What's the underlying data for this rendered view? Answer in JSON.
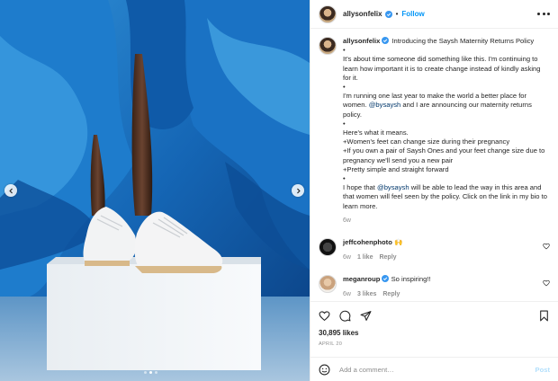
{
  "post": {
    "username": "allysonfelix",
    "follow_label": "Follow",
    "separator": "•"
  },
  "media": {
    "slide_count": 3,
    "active_slide": 1
  },
  "caption": {
    "username": "allysonfelix",
    "line1": "Introducing the Saysh Maternity Returns Policy",
    "lines": [
      "•",
      "It's about time someone did something like this. I'm continuing to learn how important it is to create change instead of kindly asking for it.",
      "•",
      "I'm running one last year to make the world a better place for women.",
      "•",
      "Here's what it means.",
      "+Women's feet can change size during their pregnancy",
      "+If you own a pair of Saysh Ones and your feet change size due to pregnancy we'll send you a new pair",
      "+Pretty simple and straight forward",
      "•"
    ],
    "mention_para": {
      "mention": "@bysaysh",
      "rest": " and I are announcing our maternity returns policy."
    },
    "closing": {
      "before": "I hope that ",
      "mention": "@bysaysh",
      "after": " will be able to lead the way in this area and that women will feel seen by the policy. Click on the link in my bio to learn more."
    },
    "time": "6w"
  },
  "comments": [
    {
      "username": "jeffcohenphoto",
      "text": "🙌",
      "time": "6w",
      "likes": "1 like",
      "reply": "Reply"
    },
    {
      "username": "meganroup",
      "text": "So inspiring!!",
      "time": "6w",
      "likes": "3 likes",
      "reply": "Reply"
    }
  ],
  "actions": {
    "likes": "30,895 likes",
    "date": "APRIL 20"
  },
  "add_comment": {
    "placeholder": "Add a comment…",
    "post_label": "Post"
  },
  "colors": {
    "accent": "#0095f6",
    "backdrop_blue": "#1a6fc1",
    "verified": "#3897f0"
  },
  "icons": [
    "chevron-left-icon",
    "chevron-right-icon",
    "verified-icon",
    "more-icon",
    "heart-icon",
    "comment-icon",
    "share-icon",
    "bookmark-icon",
    "emoji-icon"
  ]
}
